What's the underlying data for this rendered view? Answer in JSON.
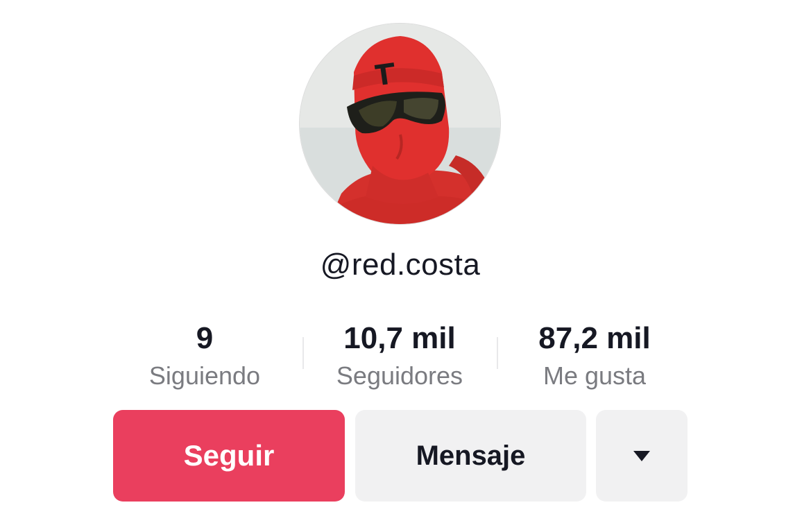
{
  "profile": {
    "username": "@red.costa",
    "avatar_description": "avatar-photo"
  },
  "stats": [
    {
      "value": "9",
      "label": "Siguiendo"
    },
    {
      "value": "10,7 mil",
      "label": "Seguidores"
    },
    {
      "value": "87,2 mil",
      "label": "Me gusta"
    }
  ],
  "actions": {
    "follow_label": "Seguir",
    "message_label": "Mensaje",
    "more_icon": "caret-down-icon"
  },
  "colors": {
    "follow_button": "#ea3f5e",
    "secondary_button": "#f1f1f2",
    "text_primary": "#161823",
    "text_secondary": "#7a7b80"
  }
}
